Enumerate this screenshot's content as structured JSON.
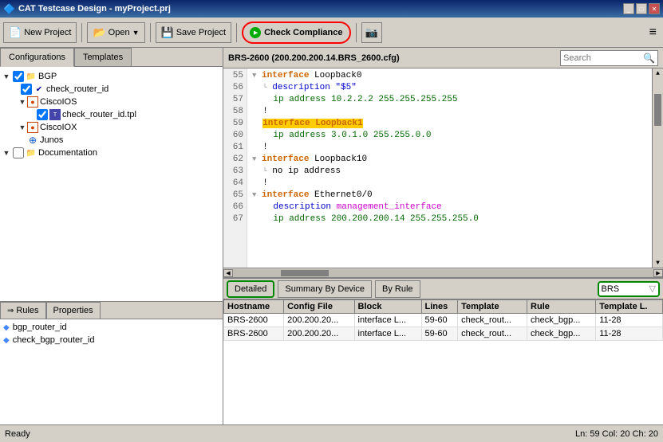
{
  "titleBar": {
    "title": "CAT Testcase Design - myProject.prj",
    "buttons": [
      "minimize",
      "maximize",
      "close"
    ]
  },
  "toolbar": {
    "newProjectLabel": "New Project",
    "openLabel": "Open",
    "saveProjectLabel": "Save Project",
    "checkComplianceLabel": "Check Compliance",
    "menuIcon": "≡"
  },
  "leftPanel": {
    "tabs": [
      "Configurations",
      "Templates"
    ],
    "activeTab": "Configurations",
    "tree": [
      {
        "level": 0,
        "expand": "▼",
        "checked": true,
        "icon": "folder",
        "label": "BGP"
      },
      {
        "level": 1,
        "expand": "",
        "checked": true,
        "icon": "check",
        "label": "check_router_id"
      },
      {
        "level": 2,
        "expand": "▼",
        "checked": false,
        "icon": "cisco-ios",
        "label": "CiscoIOS"
      },
      {
        "level": 3,
        "expand": "",
        "checked": true,
        "icon": "tpl",
        "label": "check_router_id.tpl"
      },
      {
        "level": 2,
        "expand": "▼",
        "checked": false,
        "icon": "cisco-ioxr",
        "label": "CiscoIOX"
      },
      {
        "level": 2,
        "expand": "",
        "checked": false,
        "icon": "junos",
        "label": "Junos"
      },
      {
        "level": 0,
        "expand": "▼",
        "checked": false,
        "icon": "folder",
        "label": "Documentation"
      }
    ]
  },
  "bottomLeft": {
    "tabs": [
      "Rules",
      "Properties"
    ],
    "activeTab": "Rules",
    "items": [
      "bgp_router_id",
      "check_bgp_router_id"
    ]
  },
  "editor": {
    "title": "BRS-2600 (200.200.200.14.BRS_2600.cfg)",
    "searchPlaceholder": "Search",
    "lines": [
      {
        "num": 55,
        "content": "  interface Loopback0",
        "type": "interface-collapse"
      },
      {
        "num": 56,
        "content": "    description \"$5\"",
        "type": "desc"
      },
      {
        "num": 57,
        "content": "    ip address 10.2.2.2 255.255.255.255",
        "type": "ip"
      },
      {
        "num": 58,
        "content": "  !",
        "type": "normal"
      },
      {
        "num": 59,
        "content": "  interface Loopback1",
        "type": "interface-highlight"
      },
      {
        "num": 60,
        "content": "    ip address 3.0.1.0 255.255.0.0",
        "type": "ip"
      },
      {
        "num": 61,
        "content": "  !",
        "type": "normal"
      },
      {
        "num": 62,
        "content": "  interface Loopback10",
        "type": "interface-collapse"
      },
      {
        "num": 63,
        "content": "    no ip address",
        "type": "noip"
      },
      {
        "num": 64,
        "content": "  !",
        "type": "normal"
      },
      {
        "num": 65,
        "content": "  interface Ethernet0/0",
        "type": "interface-collapse"
      },
      {
        "num": 66,
        "content": "    description management_interface",
        "type": "desc-mgmt"
      },
      {
        "num": 67,
        "content": "    ip address 200.200.200.14 255.255.255.0",
        "type": "ip-long"
      }
    ]
  },
  "results": {
    "tabs": [
      "Detailed",
      "Summary By Device",
      "By Rule"
    ],
    "activeTab": "Detailed",
    "filterValue": "BRS",
    "columns": [
      "Hostname",
      "Config File",
      "Block",
      "Lines",
      "Template",
      "Rule",
      "Template L."
    ],
    "rows": [
      {
        "hostname": "BRS-2600",
        "configFile": "200.200.20...",
        "block": "interface L...",
        "lines": "59-60",
        "template": "check_rout...",
        "rule": "check_bgp...",
        "templateL": "11-28"
      },
      {
        "hostname": "BRS-2600",
        "configFile": "200.200.20...",
        "block": "interface L...",
        "lines": "59-60",
        "template": "check_rout...",
        "rule": "check_bgp...",
        "templateL": "11-28"
      }
    ]
  },
  "statusBar": {
    "status": "Ready",
    "position": "Ln: 59  Col: 20  Ch: 20"
  }
}
